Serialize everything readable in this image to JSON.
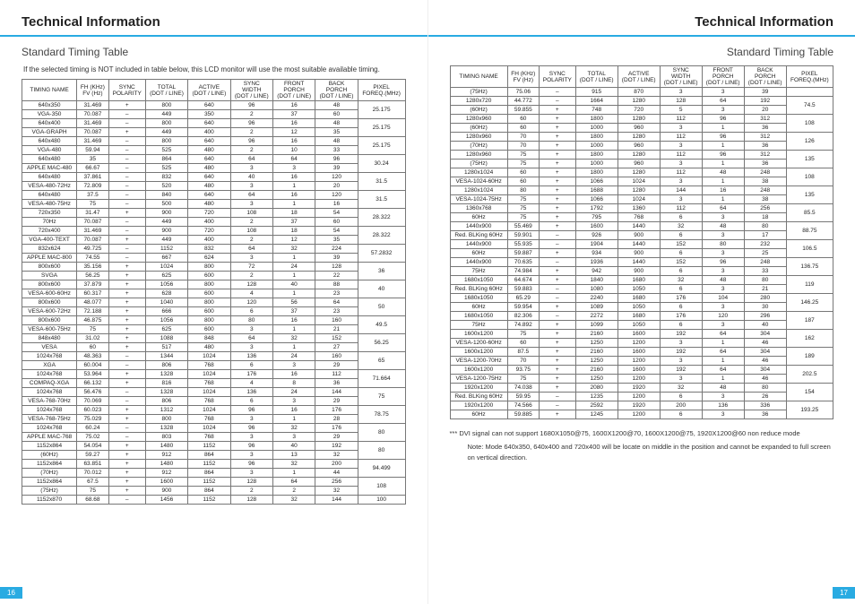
{
  "header": {
    "titleLeft": "Technical Information",
    "titleRight": "Technical Information",
    "subLeft": "Standard Timing Table",
    "subRight": "Standard Timing Table",
    "intro": "If the selected timing is NOT included in table below, this LCD monitor will use the most suitable available timing.",
    "pageLeft": "16",
    "pageRight": "17"
  },
  "notes": {
    "dvi": "*** DVI signal can not support 1680X1050@75, 1600X1200@70, 1600X1200@75, 1920X1200@60 non reduce mode",
    "vert": "Note: Mode 640x350, 640x400 and 720x400 will be locate on middle in the position and cannot be expanded to full screen on vertical direction."
  },
  "columns": [
    "TIMING NAME",
    "FH (KHz)\nFV (Hz)",
    "SYNC\nPOLARITY",
    "TOTAL\n(DOT / LINE)",
    "ACTIVE\n(DOT / LINE)",
    "SYNC\nWIDTH\n(DOT / LINE)",
    "FRONT\nPORCH\n(DOT / LINE)",
    "BACK\nPORCH\n(DOT / LINE)",
    "PIXEL\nFOREQ.(MHz)"
  ],
  "leftRows": [
    [
      "640x350",
      "31.469",
      "+",
      "800",
      "640",
      "96",
      "16",
      "48",
      "25.175",
      {
        "rs": 2
      }
    ],
    [
      "VGA-350",
      "70.087",
      "–",
      "449",
      "350",
      "2",
      "37",
      "60"
    ],
    [
      "640x400",
      "31.469",
      "–",
      "800",
      "640",
      "96",
      "16",
      "48",
      "25.175",
      {
        "rs": 2
      }
    ],
    [
      "VGA-GRAPH",
      "70.087",
      "+",
      "449",
      "400",
      "2",
      "12",
      "35"
    ],
    [
      "640x480",
      "31.469",
      "–",
      "800",
      "640",
      "96",
      "16",
      "48",
      "25.175",
      {
        "rs": 2
      }
    ],
    [
      "VGA-480",
      "59.94",
      "–",
      "525",
      "480",
      "2",
      "10",
      "33"
    ],
    [
      "640x480",
      "35",
      "–",
      "864",
      "640",
      "64",
      "64",
      "96",
      "30.24",
      {
        "rs": 2
      }
    ],
    [
      "APPLE MAC-480",
      "66.67",
      "–",
      "525",
      "480",
      "3",
      "3",
      "39"
    ],
    [
      "640x480",
      "37.861",
      "–",
      "832",
      "640",
      "40",
      "16",
      "120",
      "31.5",
      {
        "rs": 2
      }
    ],
    [
      "VESA-480-72Hz",
      "72.809",
      "–",
      "520",
      "480",
      "3",
      "1",
      "20"
    ],
    [
      "640x480",
      "37.5",
      "–",
      "840",
      "640",
      "64",
      "16",
      "120",
      "31.5",
      {
        "rs": 2
      }
    ],
    [
      "VESA-480-75Hz",
      "75",
      "–",
      "500",
      "480",
      "3",
      "1",
      "16"
    ],
    [
      "720x350",
      "31.47",
      "+",
      "900",
      "720",
      "108",
      "18",
      "54",
      "28.322",
      {
        "rs": 2
      }
    ],
    [
      "70Hz",
      "70.087",
      "–",
      "449",
      "400",
      "2",
      "37",
      "60"
    ],
    [
      "720x400",
      "31.469",
      "–",
      "900",
      "720",
      "108",
      "18",
      "54",
      "28.322",
      {
        "rs": 2
      }
    ],
    [
      "VGA-400-TEXT",
      "70.087",
      "+",
      "449",
      "400",
      "2",
      "12",
      "35"
    ],
    [
      "832x624",
      "49.725",
      "–",
      "1152",
      "832",
      "64",
      "32",
      "224",
      "57.2832",
      {
        "rs": 2
      }
    ],
    [
      "APPLE MAC-800",
      "74.55",
      "–",
      "667",
      "624",
      "3",
      "1",
      "39"
    ],
    [
      "800x600",
      "35.156",
      "+",
      "1024",
      "800",
      "72",
      "24",
      "128",
      "36",
      {
        "rs": 2
      }
    ],
    [
      "SVGA",
      "56.25",
      "+",
      "625",
      "600",
      "2",
      "1",
      "22"
    ],
    [
      "800x600",
      "37.879",
      "+",
      "1056",
      "800",
      "128",
      "40",
      "88",
      "40",
      {
        "rs": 2
      }
    ],
    [
      "VESA-600-60Hz",
      "60.317",
      "+",
      "628",
      "600",
      "4",
      "1",
      "23"
    ],
    [
      "800x600",
      "48.077",
      "+",
      "1040",
      "800",
      "120",
      "56",
      "64",
      "50",
      {
        "rs": 2
      }
    ],
    [
      "VESA-600-72Hz",
      "72.188",
      "+",
      "666",
      "600",
      "6",
      "37",
      "23"
    ],
    [
      "800x600",
      "46.875",
      "+",
      "1056",
      "800",
      "80",
      "16",
      "160",
      "49.5",
      {
        "rs": 2
      }
    ],
    [
      "VESA-600-75Hz",
      "75",
      "+",
      "625",
      "600",
      "3",
      "1",
      "21"
    ],
    [
      "848x480",
      "31.02",
      "+",
      "1088",
      "848",
      "64",
      "32",
      "152",
      "56.25",
      {
        "rs": 2
      }
    ],
    [
      "VESA",
      "60",
      "+",
      "517",
      "480",
      "3",
      "1",
      "27"
    ],
    [
      "1024x768",
      "48.363",
      "–",
      "1344",
      "1024",
      "136",
      "24",
      "160",
      "65",
      {
        "rs": 2
      }
    ],
    [
      "XGA",
      "60.004",
      "–",
      "806",
      "768",
      "6",
      "3",
      "29"
    ],
    [
      "1024x768",
      "53.964",
      "+",
      "1328",
      "1024",
      "176",
      "16",
      "112",
      "71.664",
      {
        "rs": 2
      }
    ],
    [
      "COMPAQ-XGA",
      "66.132",
      "+",
      "816",
      "768",
      "4",
      "8",
      "36"
    ],
    [
      "1024x768",
      "56.476",
      "–",
      "1328",
      "1024",
      "136",
      "24",
      "144",
      "75",
      {
        "rs": 2
      }
    ],
    [
      "VESA-768-70Hz",
      "70.069",
      "–",
      "806",
      "768",
      "6",
      "3",
      "29"
    ],
    [
      "1024x768",
      "60.023",
      "+",
      "1312",
      "1024",
      "96",
      "16",
      "176",
      "78.75",
      {
        "rs": 2
      }
    ],
    [
      "VESA-768-75Hz",
      "75.029",
      "+",
      "800",
      "768",
      "3",
      "1",
      "28"
    ],
    [
      "1024x768",
      "60.24",
      "–",
      "1328",
      "1024",
      "96",
      "32",
      "176",
      "80",
      {
        "rs": 2
      }
    ],
    [
      "APPLE MAC-768",
      "75.02",
      "–",
      "803",
      "768",
      "3",
      "3",
      "29"
    ],
    [
      "1152x864",
      "54.054",
      "+",
      "1480",
      "1152",
      "96",
      "40",
      "192",
      "80",
      {
        "rs": 2
      }
    ],
    [
      "(60Hz)",
      "59.27",
      "+",
      "912",
      "864",
      "3",
      "13",
      "32"
    ],
    [
      "1152x864",
      "63.851",
      "+",
      "1480",
      "1152",
      "96",
      "32",
      "200",
      "94.499",
      {
        "rs": 2
      }
    ],
    [
      "(70Hz)",
      "70.012",
      "+",
      "912",
      "864",
      "3",
      "1",
      "44"
    ],
    [
      "1152x864",
      "67.5",
      "+",
      "1600",
      "1152",
      "128",
      "64",
      "256",
      "108",
      {
        "rs": 2
      }
    ],
    [
      "(75Hz)",
      "75",
      "+",
      "900",
      "864",
      "2",
      "2",
      "32"
    ],
    [
      "1152x870",
      "68.68",
      "–",
      "1456",
      "1152",
      "128",
      "32",
      "144",
      "100",
      {
        "rs": 999
      }
    ]
  ],
  "rightRows": [
    [
      "(75Hz)",
      "75.06",
      "–",
      "915",
      "870",
      "3",
      "3",
      "39",
      ""
    ],
    [
      "1280x720",
      "44.772",
      "–",
      "1664",
      "1280",
      "128",
      "64",
      "192",
      "74.5",
      {
        "rs": 2
      }
    ],
    [
      "(60Hz)",
      "59.855",
      "+",
      "748",
      "720",
      "5",
      "3",
      "20"
    ],
    [
      "1280x960",
      "60",
      "+",
      "1800",
      "1280",
      "112",
      "96",
      "312",
      "108",
      {
        "rs": 2
      }
    ],
    [
      "(60Hz)",
      "60",
      "+",
      "1000",
      "960",
      "3",
      "1",
      "36"
    ],
    [
      "1280x960",
      "70",
      "+",
      "1800",
      "1280",
      "112",
      "96",
      "312",
      "126",
      {
        "rs": 2
      }
    ],
    [
      "(70Hz)",
      "70",
      "+",
      "1000",
      "960",
      "3",
      "1",
      "36"
    ],
    [
      "1280x960",
      "75",
      "+",
      "1800",
      "1280",
      "112",
      "96",
      "312",
      "135",
      {
        "rs": 2
      }
    ],
    [
      "(75Hz)",
      "75",
      "+",
      "1000",
      "960",
      "3",
      "1",
      "36"
    ],
    [
      "1280x1024",
      "60",
      "+",
      "1800",
      "1280",
      "112",
      "48",
      "248",
      "108",
      {
        "rs": 2
      }
    ],
    [
      "VESA-1024-60Hz",
      "60",
      "+",
      "1066",
      "1024",
      "3",
      "1",
      "38"
    ],
    [
      "1280x1024",
      "80",
      "+",
      "1688",
      "1280",
      "144",
      "16",
      "248",
      "135",
      {
        "rs": 2
      }
    ],
    [
      "VESA-1024-75Hz",
      "75",
      "+",
      "1066",
      "1024",
      "3",
      "1",
      "38"
    ],
    [
      "1360x768",
      "75",
      "+",
      "1792",
      "1360",
      "112",
      "64",
      "256",
      "85.5",
      {
        "rs": 2
      }
    ],
    [
      "60Hz",
      "75",
      "+",
      "795",
      "768",
      "6",
      "3",
      "18"
    ],
    [
      "1440x900",
      "55.469",
      "+",
      "1600",
      "1440",
      "32",
      "48",
      "80",
      "88.75",
      {
        "rs": 2
      }
    ],
    [
      "Red. BLKing 60Hz",
      "59.901",
      "–",
      "926",
      "900",
      "6",
      "3",
      "17"
    ],
    [
      "1440x900",
      "55.935",
      "–",
      "1904",
      "1440",
      "152",
      "80",
      "232",
      "106.5",
      {
        "rs": 2
      }
    ],
    [
      "60Hz",
      "59.887",
      "+",
      "934",
      "900",
      "6",
      "3",
      "25"
    ],
    [
      "1440x900",
      "70.635",
      "–",
      "1936",
      "1440",
      "152",
      "96",
      "248",
      "136.75",
      {
        "rs": 2
      }
    ],
    [
      "75Hz",
      "74.984",
      "+",
      "942",
      "900",
      "6",
      "3",
      "33"
    ],
    [
      "1680x1050",
      "64.674",
      "+",
      "1840",
      "1680",
      "32",
      "48",
      "80",
      "119",
      {
        "rs": 2
      }
    ],
    [
      "Red. BLKing 60Hz",
      "59.883",
      "–",
      "1080",
      "1050",
      "6",
      "3",
      "21"
    ],
    [
      "1680x1050",
      "65.29",
      "–",
      "2240",
      "1680",
      "176",
      "104",
      "280",
      "146.25",
      {
        "rs": 2
      }
    ],
    [
      "60Hz",
      "59.954",
      "+",
      "1089",
      "1050",
      "6",
      "3",
      "30"
    ],
    [
      "1680x1050",
      "82.306",
      "–",
      "2272",
      "1680",
      "176",
      "120",
      "296",
      "187",
      {
        "rs": 2
      }
    ],
    [
      "75Hz",
      "74.892",
      "+",
      "1099",
      "1050",
      "6",
      "3",
      "40"
    ],
    [
      "1600x1200",
      "75",
      "+",
      "2160",
      "1600",
      "192",
      "64",
      "304",
      "162",
      {
        "rs": 2
      }
    ],
    [
      "VESA-1200-60Hz",
      "60",
      "+",
      "1250",
      "1200",
      "3",
      "1",
      "46"
    ],
    [
      "1600x1200",
      "87.5",
      "+",
      "2160",
      "1600",
      "192",
      "64",
      "304",
      "189",
      {
        "rs": 2
      }
    ],
    [
      "VESA-1200-70Hz",
      "70",
      "+",
      "1250",
      "1200",
      "3",
      "1",
      "46"
    ],
    [
      "1600x1200",
      "93.75",
      "+",
      "2160",
      "1600",
      "192",
      "64",
      "304",
      "202.5",
      {
        "rs": 2
      }
    ],
    [
      "VESA-1200-75Hz",
      "75",
      "+",
      "1250",
      "1200",
      "3",
      "1",
      "46"
    ],
    [
      "1920x1200",
      "74.038",
      "+",
      "2080",
      "1920",
      "32",
      "48",
      "80",
      "154",
      {
        "rs": 2
      }
    ],
    [
      "Red. BLKing 60Hz",
      "59.95",
      "–",
      "1235",
      "1200",
      "6",
      "3",
      "26"
    ],
    [
      "1920x1200",
      "74.566",
      "–",
      "2592",
      "1920",
      "200",
      "136",
      "336",
      "193.25",
      {
        "rs": 2
      }
    ],
    [
      "60Hz",
      "59.885",
      "+",
      "1245",
      "1200",
      "6",
      "3",
      "36"
    ]
  ]
}
